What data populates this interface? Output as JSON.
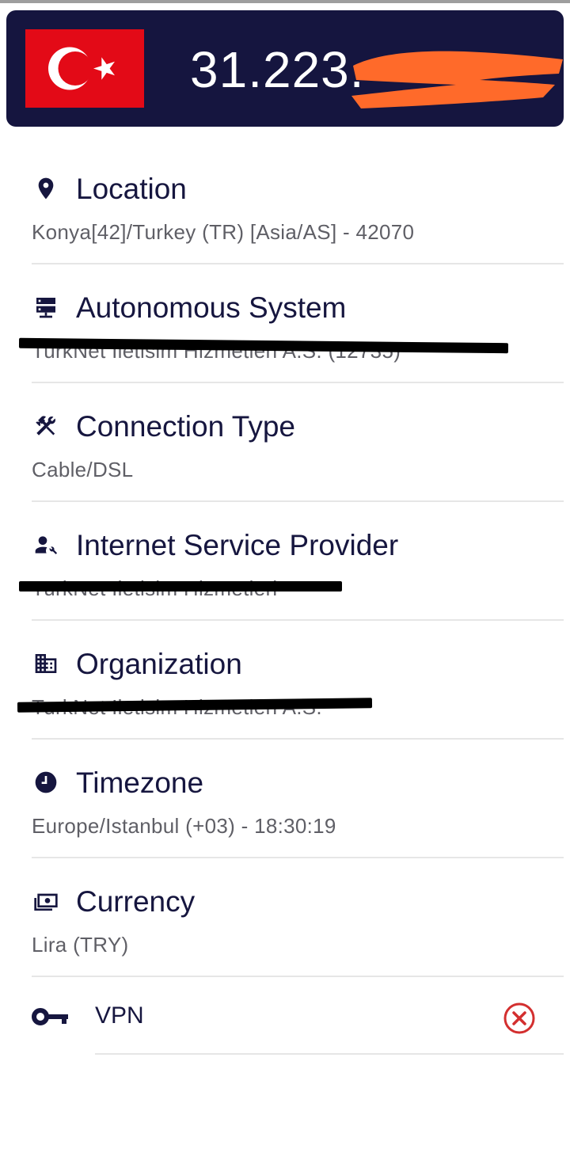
{
  "header": {
    "ip": "31.223.",
    "country_flag": "turkey-flag"
  },
  "sections": {
    "location": {
      "title": "Location",
      "value": "Konya[42]/Turkey (TR) [Asia/AS] - 42070",
      "icon": "location-pin-icon"
    },
    "asn": {
      "title": "Autonomous System",
      "value": "TurkNet Iletisim Hizmetleri A.S. (12735)",
      "icon": "server-icon"
    },
    "connection": {
      "title": "Connection Type",
      "value": "Cable/DSL",
      "icon": "tools-icon"
    },
    "isp": {
      "title": "Internet Service Provider",
      "value": "TurkNet Iletisim Hizmetleri",
      "icon": "person-wrench-icon"
    },
    "organization": {
      "title": "Organization",
      "value": "TurkNet Iletisim Hizmetleri A.S.",
      "icon": "building-icon"
    },
    "timezone": {
      "title": "Timezone",
      "value": "Europe/Istanbul (+03) - 18:30:19",
      "icon": "clock-icon"
    },
    "currency": {
      "title": "Currency",
      "value": "Lira (TRY)",
      "icon": "money-icon"
    }
  },
  "vpn": {
    "label": "VPN",
    "status": "negative",
    "status_color": "#d32f2f",
    "icon": "key-icon"
  },
  "colors": {
    "header_bg": "#15153f",
    "flag_red": "#e30a17",
    "redaction_orange": "#ff6a2a",
    "text_dark": "#16163f",
    "text_muted": "#5f5f66"
  }
}
